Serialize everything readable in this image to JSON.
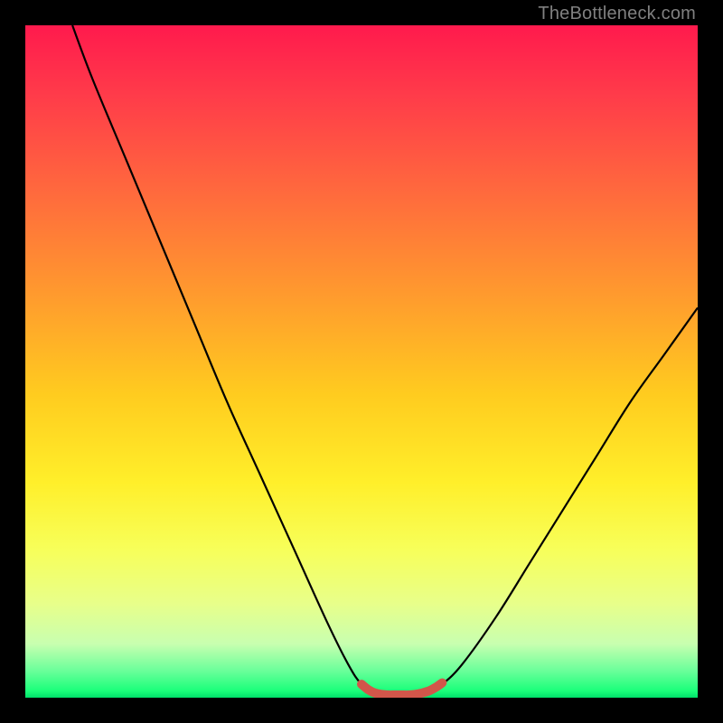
{
  "watermark": "TheBottleneck.com",
  "chart_data": {
    "type": "line",
    "title": "",
    "xlabel": "",
    "ylabel": "",
    "xlim": [
      0,
      100
    ],
    "ylim": [
      0,
      100
    ],
    "grid": false,
    "legend": false,
    "background_gradient": {
      "stops": [
        {
          "pct": 0,
          "color": "#ff1a4d"
        },
        {
          "pct": 10,
          "color": "#ff3a4a"
        },
        {
          "pct": 25,
          "color": "#ff6a3d"
        },
        {
          "pct": 40,
          "color": "#ff9a2e"
        },
        {
          "pct": 55,
          "color": "#ffcc1f"
        },
        {
          "pct": 68,
          "color": "#ffef2a"
        },
        {
          "pct": 78,
          "color": "#f7ff5a"
        },
        {
          "pct": 86,
          "color": "#e8ff8a"
        },
        {
          "pct": 92,
          "color": "#c8ffb0"
        },
        {
          "pct": 96,
          "color": "#6aff9a"
        },
        {
          "pct": 99,
          "color": "#1aff7a"
        },
        {
          "pct": 100,
          "color": "#00e06a"
        }
      ]
    },
    "series": [
      {
        "name": "bottleneck-curve",
        "type": "line",
        "color": "#000000",
        "x": [
          7,
          10,
          15,
          20,
          25,
          30,
          35,
          40,
          45,
          48,
          50,
          52,
          55,
          58,
          60,
          62,
          65,
          70,
          75,
          80,
          85,
          90,
          95,
          100
        ],
        "y": [
          100,
          92,
          80,
          68,
          56,
          44,
          33,
          22,
          11,
          5,
          2,
          0.8,
          0.4,
          0.4,
          0.8,
          2,
          5,
          12,
          20,
          28,
          36,
          44,
          51,
          58
        ]
      },
      {
        "name": "optimal-zone-marker",
        "type": "line",
        "color": "#d2564a",
        "stroke_width": 6,
        "x": [
          50,
          51,
          52,
          53,
          54,
          55,
          56,
          57,
          58,
          59,
          60,
          61,
          62
        ],
        "y": [
          2.0,
          1.2,
          0.7,
          0.5,
          0.4,
          0.4,
          0.4,
          0.4,
          0.5,
          0.7,
          1.0,
          1.5,
          2.2
        ]
      }
    ]
  }
}
